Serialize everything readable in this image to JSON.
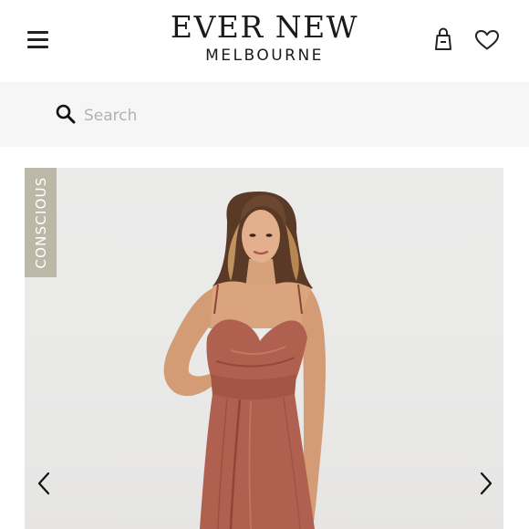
{
  "header": {
    "menu_icon": "hamburger-menu-icon",
    "brand_name": "EVER NEW",
    "brand_city": "MELBOURNE",
    "bag_icon": "shopping-bag-icon",
    "wishlist_icon": "heart-icon"
  },
  "search": {
    "icon": "search-icon",
    "placeholder": "Search"
  },
  "product": {
    "badge": "CONSCIOUS",
    "image_description_icon": "product-photo",
    "prev_icon": "chevron-left-icon",
    "next_icon": "chevron-right-icon"
  },
  "colors": {
    "badge_background": "#bcb8a7",
    "search_background": "#f6f6f6",
    "dress": "#b0604f",
    "text": "#1a1a1a"
  }
}
